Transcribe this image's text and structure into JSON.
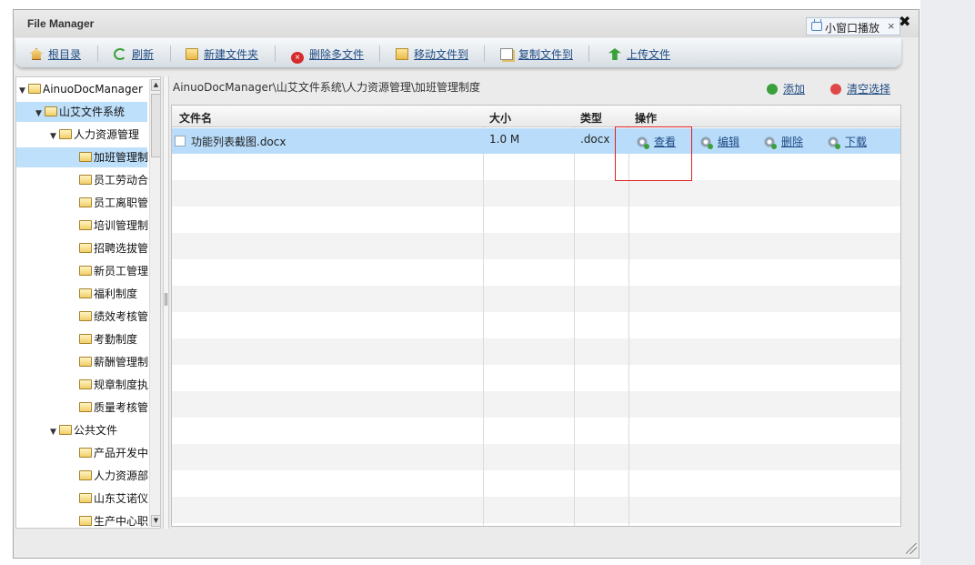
{
  "window": {
    "title": "File Manager",
    "mini_label": "小窗口播放",
    "mini_close": "×",
    "close": "✖"
  },
  "toolbar": {
    "items": [
      {
        "label": "根目录",
        "icon": "home-icon"
      },
      {
        "label": "刷新",
        "icon": "refresh-icon"
      },
      {
        "label": "新建文件夹",
        "icon": "folder-add-icon"
      },
      {
        "label": "删除多文件",
        "icon": "delete-icon"
      },
      {
        "label": "移动文件到",
        "icon": "move-icon"
      },
      {
        "label": "复制文件到",
        "icon": "copy-icon"
      },
      {
        "label": "上传文件",
        "icon": "upload-icon"
      }
    ]
  },
  "tree": {
    "root": "AinuoDocManager",
    "l1": "山艾文件系统",
    "l2a": "人力资源管理",
    "l2a_children": [
      "加班管理制",
      "员工劳动合",
      "员工离职管",
      "培训管理制",
      "招聘选拔管",
      "新员工管理",
      "福利制度",
      "绩效考核管",
      "考勤制度",
      "薪酬管理制",
      "规章制度执",
      "质量考核管"
    ],
    "l2b": "公共文件",
    "l2b_children": [
      "产品开发中",
      "人力资源部",
      "山东艾诺仪",
      "生产中心职"
    ]
  },
  "main": {
    "breadcrumb": "AinuoDocManager\\山艾文件系统\\人力资源管理\\加班管理制度",
    "add": "添加",
    "clear": "清空选择",
    "columns": {
      "name": "文件名",
      "size": "大小",
      "type": "类型",
      "ops": "操作"
    },
    "files": [
      {
        "name": "功能列表截图.docx",
        "size": "1.0 M",
        "type": ".docx",
        "ops": {
          "view": "查看",
          "edit": "编辑",
          "delete": "删除",
          "download": "下载"
        }
      }
    ]
  },
  "colors": {
    "selection": "#b8dcfa",
    "link": "#1e4a82",
    "highlight_box": "#e02020"
  }
}
